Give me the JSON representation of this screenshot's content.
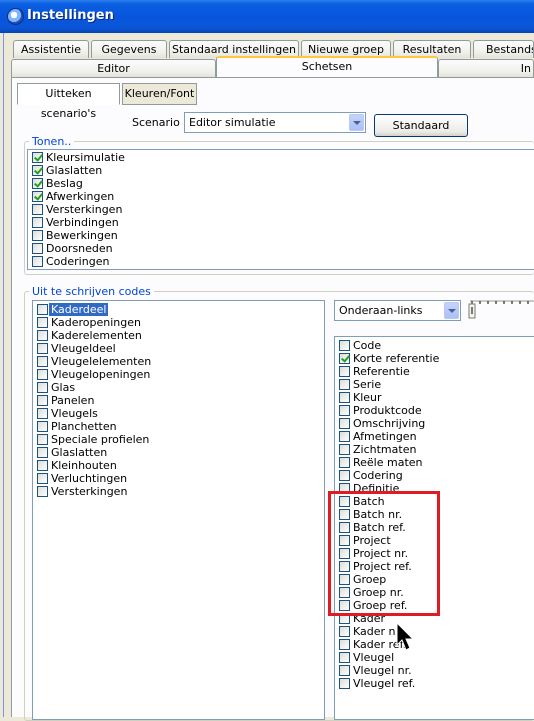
{
  "window": {
    "title": "Instellingen"
  },
  "tabs_row1": [
    "Assistentie",
    "Gegevens",
    "Standaard instellingen",
    "Nieuwe groep",
    "Resultaten",
    "Bestandsp"
  ],
  "tabs_row2": [
    "Editor",
    "Schetsen",
    "In"
  ],
  "active_tab": "Schetsen",
  "subtabs": [
    "Uitteken scenario's",
    "Kleuren/Font"
  ],
  "scenario": {
    "label": "Scenario :",
    "value": "Editor simulatie",
    "default_button": "Standaard"
  },
  "tonen": {
    "title": "Tonen..",
    "items": [
      {
        "label": "Kleursimulatie",
        "checked": true
      },
      {
        "label": "Glaslatten",
        "checked": true
      },
      {
        "label": "Beslag",
        "checked": true
      },
      {
        "label": "Afwerkingen",
        "checked": true
      },
      {
        "label": "Versterkingen",
        "checked": false
      },
      {
        "label": "Verbindingen",
        "checked": false
      },
      {
        "label": "Bewerkingen",
        "checked": false
      },
      {
        "label": "Doorsneden",
        "checked": false
      },
      {
        "label": "Coderingen",
        "checked": false
      }
    ]
  },
  "codes": {
    "title": "Uit te schrijven codes",
    "left_items": [
      {
        "label": "Kaderdeel",
        "checked": false,
        "selected": true
      },
      {
        "label": "Kaderopeningen",
        "checked": false
      },
      {
        "label": "Kaderelementen",
        "checked": false
      },
      {
        "label": "Vleugeldeel",
        "checked": false
      },
      {
        "label": "Vleugelelementen",
        "checked": false
      },
      {
        "label": "Vleugelopeningen",
        "checked": false
      },
      {
        "label": "Glas",
        "checked": false
      },
      {
        "label": "Panelen",
        "checked": false
      },
      {
        "label": "Vleugels",
        "checked": false
      },
      {
        "label": "Planchetten",
        "checked": false
      },
      {
        "label": "Speciale profielen",
        "checked": false
      },
      {
        "label": "Glaslatten",
        "checked": false
      },
      {
        "label": "Kleinhouten",
        "checked": false
      },
      {
        "label": "Verluchtingen",
        "checked": false
      },
      {
        "label": "Versterkingen",
        "checked": false
      }
    ],
    "position_value": "Onderaan-links",
    "right_items": [
      {
        "label": "Code",
        "checked": false
      },
      {
        "label": "Korte referentie",
        "checked": true
      },
      {
        "label": "Referentie",
        "checked": false
      },
      {
        "label": "Serie",
        "checked": false
      },
      {
        "label": "Kleur",
        "checked": false
      },
      {
        "label": "Produktcode",
        "checked": false
      },
      {
        "label": "Omschrijving",
        "checked": false
      },
      {
        "label": "Afmetingen",
        "checked": false
      },
      {
        "label": "Zichtmaten",
        "checked": false
      },
      {
        "label": "Reële maten",
        "checked": false
      },
      {
        "label": "Codering",
        "checked": false
      },
      {
        "label": "Definitie",
        "checked": false
      },
      {
        "label": "Batch",
        "checked": false
      },
      {
        "label": "Batch nr.",
        "checked": false
      },
      {
        "label": "Batch ref.",
        "checked": false
      },
      {
        "label": "Project",
        "checked": false
      },
      {
        "label": "Project nr.",
        "checked": false
      },
      {
        "label": "Project ref.",
        "checked": false
      },
      {
        "label": "Groep",
        "checked": false
      },
      {
        "label": "Groep nr.",
        "checked": false
      },
      {
        "label": "Groep ref.",
        "checked": false
      },
      {
        "label": "Kader",
        "checked": false
      },
      {
        "label": "Kader nr.",
        "checked": false
      },
      {
        "label": "Kader ref.",
        "checked": false
      },
      {
        "label": "Vleugel",
        "checked": false
      },
      {
        "label": "Vleugel nr.",
        "checked": false
      },
      {
        "label": "Vleugel ref.",
        "checked": false
      }
    ]
  },
  "colors": {
    "titlebar": "#0855dd",
    "selection": "#316ac5",
    "highlight": "#e11b22",
    "group_title": "#0046d5",
    "active_tab_accent": "#ffc83c"
  },
  "icons": {
    "app": "app-icon",
    "dropdown": "chevron-down-icon",
    "cursor": "mouse-pointer-icon"
  }
}
